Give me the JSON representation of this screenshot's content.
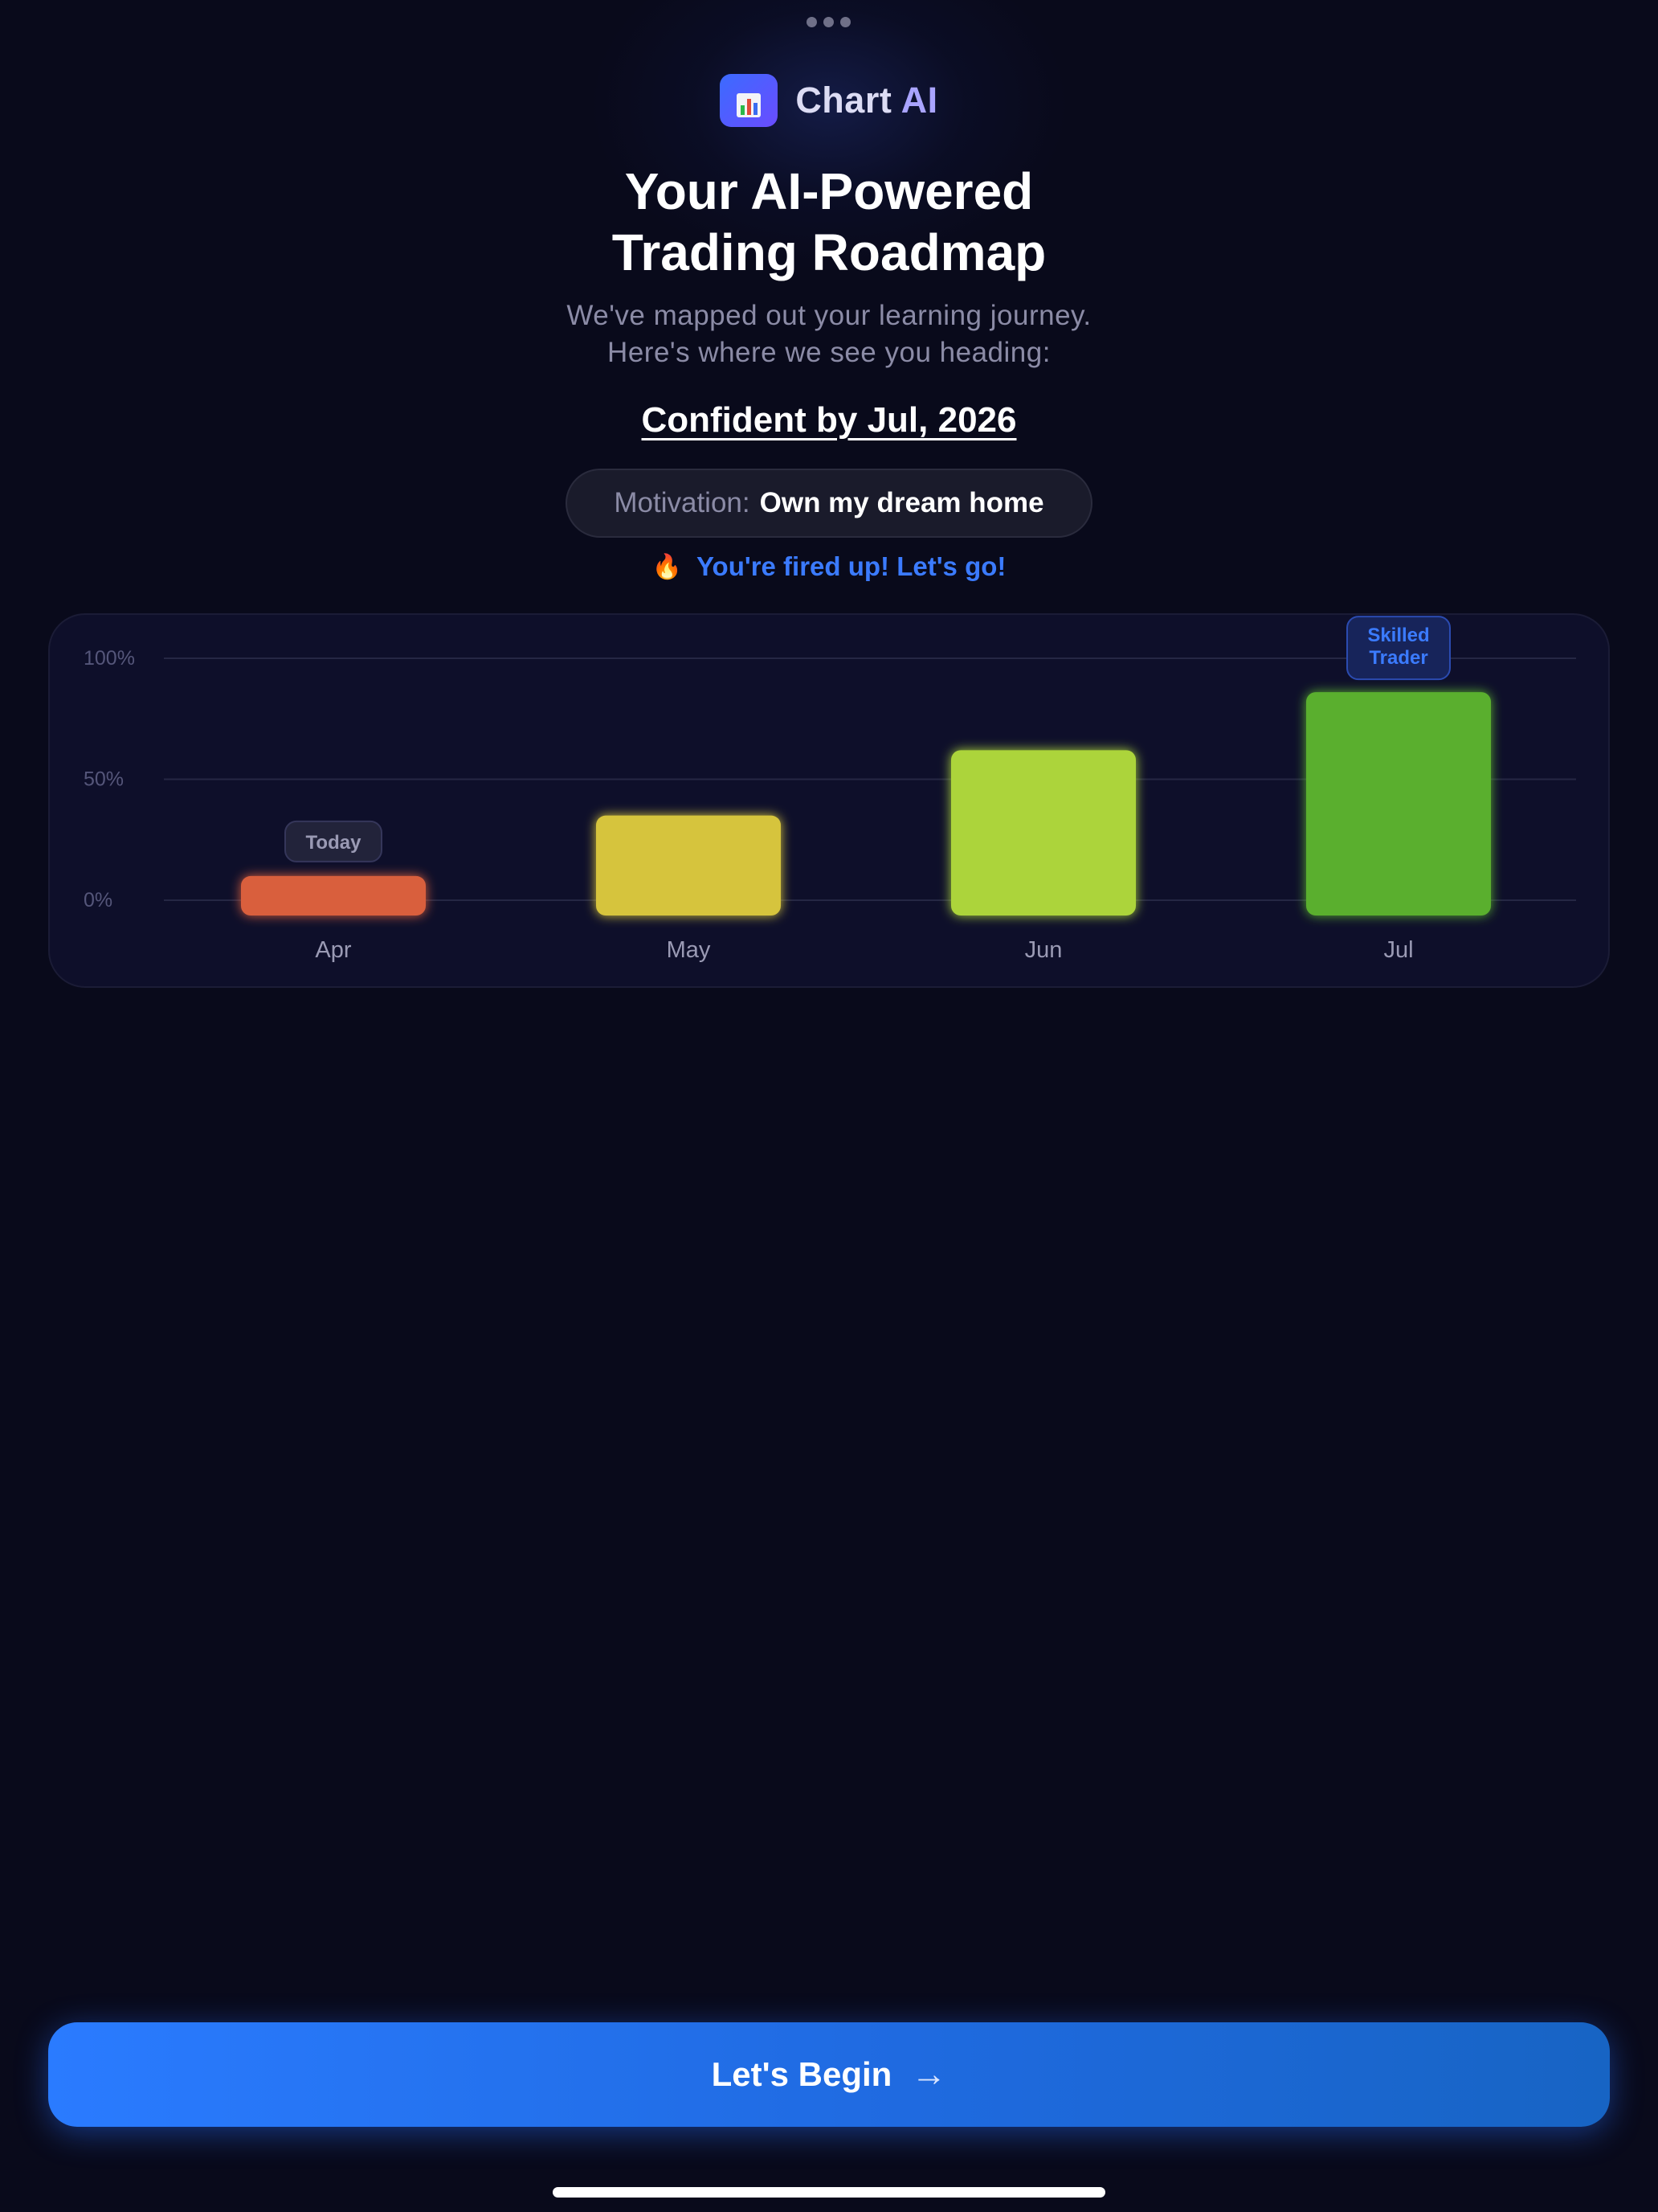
{
  "brand": {
    "name_part1": "Chart",
    "name_part2": "AI",
    "logo_icon": "bar-chart-icon",
    "logo_gradient": [
      "#3b6bff",
      "#6a4cff"
    ]
  },
  "headline": {
    "line1": "Your AI-Powered",
    "line2": "Trading Roadmap"
  },
  "subtitle": {
    "line1": "We've mapped out your learning journey.",
    "line2": "Here's where we see you heading:"
  },
  "target": "Confident by Jul, 2026",
  "motivation": {
    "label": "Motivation:",
    "value": "Own my dream home"
  },
  "fired": {
    "icon": "fire-icon",
    "text": "You're fired up! Let's go!"
  },
  "chart_data": {
    "type": "bar",
    "title": "",
    "xlabel": "",
    "ylabel": "",
    "categories": [
      "Apr",
      "May",
      "Jun",
      "Jul"
    ],
    "values": [
      10,
      35,
      62,
      86
    ],
    "ylim": [
      0,
      100
    ],
    "y_ticks": [
      "100%",
      "50%",
      "0%"
    ],
    "y_tick_values": [
      100,
      50,
      0
    ],
    "grid": true,
    "bar_colors": [
      "#d95f3c",
      "#d6c43c",
      "#acd43a",
      "#5aaf2e"
    ],
    "annotations": [
      {
        "category": "Apr",
        "text": "Today"
      },
      {
        "category": "Jul",
        "text_lines": [
          "Skilled",
          "Trader"
        ]
      }
    ]
  },
  "cta": {
    "label": "Let's Begin",
    "icon": "arrow-right-icon"
  },
  "colors": {
    "background": "#090a1b",
    "accent": "#2a7bff",
    "muted_text": "#8b8ba6"
  }
}
